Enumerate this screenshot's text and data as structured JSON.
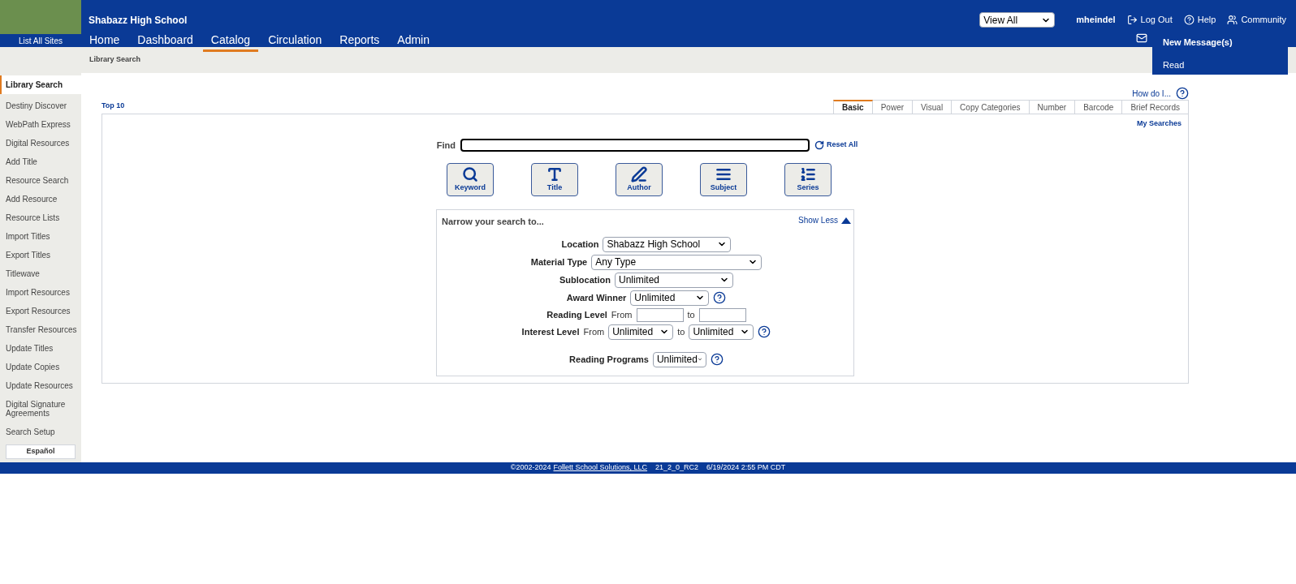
{
  "header": {
    "site_link": "List All Sites",
    "school": "Shabazz High School",
    "nav": [
      {
        "label": "Home",
        "selected": false
      },
      {
        "label": "Dashboard",
        "selected": false
      },
      {
        "label": "Catalog",
        "selected": true
      },
      {
        "label": "Circulation",
        "selected": false
      },
      {
        "label": "Reports",
        "selected": false
      },
      {
        "label": "Admin",
        "selected": false
      }
    ],
    "view_select": "View All",
    "user": "mheindel",
    "logout": "Log Out",
    "help": "Help",
    "community": "Community",
    "messages_menu": [
      "New Message(s)",
      "Read"
    ]
  },
  "breadcrumb": "Library Search",
  "sidebar": {
    "items": [
      {
        "label": "Library Search",
        "selected": true
      },
      {
        "label": "Destiny Discover",
        "selected": false
      },
      {
        "label": "WebPath Express",
        "selected": false
      },
      {
        "label": "Digital Resources",
        "selected": false
      },
      {
        "label": "Add Title",
        "selected": false
      },
      {
        "label": "Resource Search",
        "selected": false
      },
      {
        "label": "Add Resource",
        "selected": false
      },
      {
        "label": "Resource Lists",
        "selected": false
      },
      {
        "label": "Import Titles",
        "selected": false
      },
      {
        "label": "Export Titles",
        "selected": false
      },
      {
        "label": "Titlewave",
        "selected": false
      },
      {
        "label": "Import Resources",
        "selected": false
      },
      {
        "label": "Export Resources",
        "selected": false
      },
      {
        "label": "Transfer Resources",
        "selected": false
      },
      {
        "label": "Update Titles",
        "selected": false
      },
      {
        "label": "Update Copies",
        "selected": false
      },
      {
        "label": "Update Resources",
        "selected": false
      },
      {
        "label": "Digital Signature Agreements",
        "selected": false
      },
      {
        "label": "Search Setup",
        "selected": false
      }
    ],
    "language_button": "Español"
  },
  "main": {
    "how_do_i": "How do I...",
    "top10": "Top 10",
    "tabs": [
      {
        "label": "Basic",
        "selected": true
      },
      {
        "label": "Power",
        "selected": false
      },
      {
        "label": "Visual",
        "selected": false
      },
      {
        "label": "Copy Categories",
        "selected": false
      },
      {
        "label": "Number",
        "selected": false
      },
      {
        "label": "Barcode",
        "selected": false
      },
      {
        "label": "Brief Records",
        "selected": false
      }
    ],
    "my_searches": "My Searches",
    "find_label": "Find",
    "reset_all": "Reset All",
    "search_buttons": [
      {
        "kind": "keyword",
        "label": "Keyword"
      },
      {
        "kind": "title",
        "label": "Title"
      },
      {
        "kind": "author",
        "label": "Author"
      },
      {
        "kind": "subject",
        "label": "Subject"
      },
      {
        "kind": "series",
        "label": "Series"
      }
    ],
    "narrow": {
      "title": "Narrow your search to...",
      "toggle": "Show Less",
      "filters": [
        {
          "kind": "select",
          "label": "Location",
          "value": "Shabazz High School",
          "help": false
        },
        {
          "kind": "select",
          "label": "Material Type",
          "value": "Any Type",
          "help": false
        },
        {
          "kind": "select",
          "label": "Sublocation",
          "value": "Unlimited",
          "help": false
        },
        {
          "kind": "select",
          "label": "Award Winner",
          "value": "Unlimited",
          "help": true
        },
        {
          "kind": "range-input",
          "label": "Reading Level",
          "from": "From",
          "to": "to",
          "help": false
        },
        {
          "kind": "range-select",
          "label": "Interest Level",
          "from": "From",
          "to": "to",
          "from_value": "Unlimited",
          "to_value": "Unlimited",
          "help": true
        },
        {
          "kind": "select",
          "label": "Reading Programs",
          "value": "Unlimited",
          "help": true
        }
      ]
    }
  },
  "footer": {
    "copyright": "©2002-2024",
    "company_link": "Follett School Solutions, LLC",
    "version": "21_2_0_RC2",
    "timestamp": "6/19/2024 2:55 PM CDT"
  }
}
